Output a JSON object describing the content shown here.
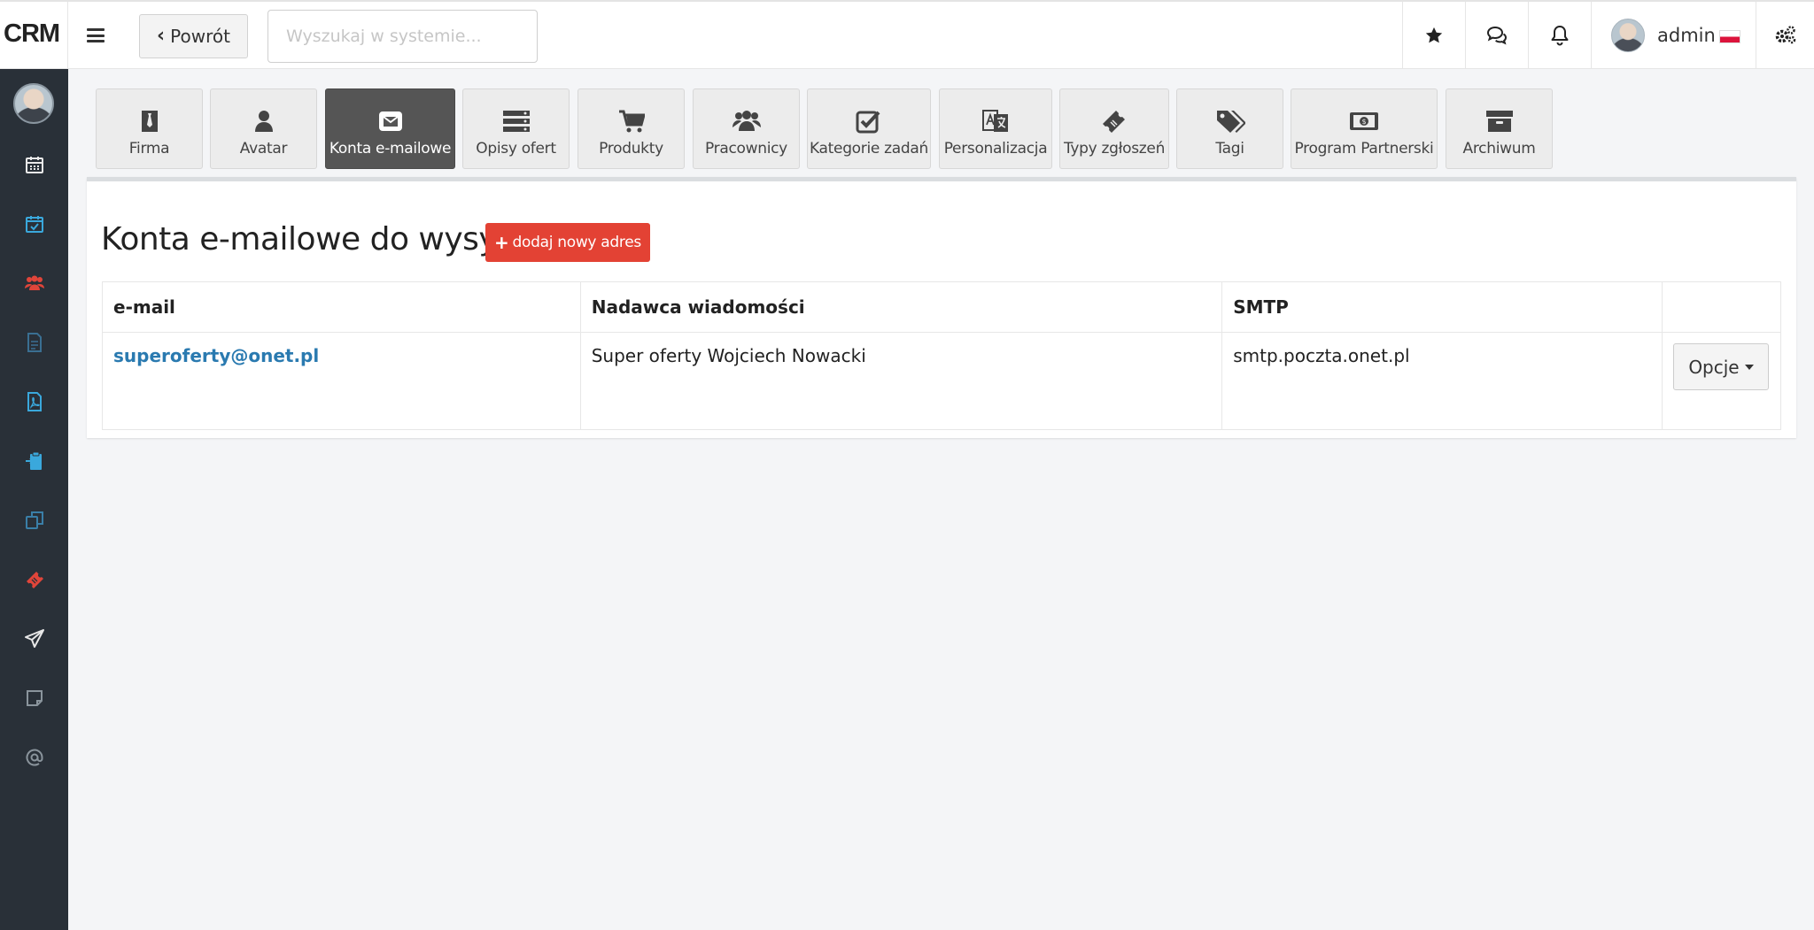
{
  "app": {
    "logo": "CRM"
  },
  "header": {
    "back_label": "Powrót",
    "search_placeholder": "Wyszukaj w systemie...",
    "user_name": "admin"
  },
  "tabs": [
    {
      "label": "Firma",
      "icon": "tie-icon",
      "active": false
    },
    {
      "label": "Avatar",
      "icon": "user-icon",
      "active": false
    },
    {
      "label": "Konta e-mailowe",
      "icon": "envelope-icon",
      "active": true
    },
    {
      "label": "Opisy ofert",
      "icon": "server-icon",
      "active": false
    },
    {
      "label": "Produkty",
      "icon": "cart-icon",
      "active": false
    },
    {
      "label": "Pracownicy",
      "icon": "users-icon",
      "active": false
    },
    {
      "label": "Kategorie zadań",
      "icon": "check-square-icon",
      "active": false
    },
    {
      "label": "Personalizacja",
      "icon": "translate-icon",
      "active": false
    },
    {
      "label": "Typy zgłoszeń",
      "icon": "ticket-icon",
      "active": false
    },
    {
      "label": "Tagi",
      "icon": "tags-icon",
      "active": false
    },
    {
      "label": "Program Partnerski",
      "icon": "money-icon",
      "active": false
    },
    {
      "label": "Archiwum",
      "icon": "archive-icon",
      "active": false
    }
  ],
  "panel": {
    "title": "Konta e-mailowe do wysyłki",
    "add_button": "dodaj nowy adres"
  },
  "table": {
    "headers": [
      "e-mail",
      "Nadawca wiadomości",
      "SMTP",
      ""
    ],
    "rows": [
      {
        "email": "superoferty@onet.pl",
        "sender": "Super oferty Wojciech Nowacki",
        "smtp": "smtp.poczta.onet.pl",
        "options_label": "Opcje"
      }
    ]
  },
  "sidebar": {
    "items": [
      {
        "icon": "calendar-icon",
        "color": "#e8e8e8"
      },
      {
        "icon": "calendar-check-icon",
        "color": "#3aa8dc"
      },
      {
        "icon": "users-icon",
        "color": "#e0453a"
      },
      {
        "icon": "file-icon",
        "color": "#3a6f92"
      },
      {
        "icon": "file-pdf-icon",
        "color": "#3aa8dc"
      },
      {
        "icon": "clipboard-icon",
        "color": "#3aa8dc"
      },
      {
        "icon": "copy-icon",
        "color": "#3a7fa8"
      },
      {
        "icon": "ticket-icon",
        "color": "#e0453a"
      },
      {
        "icon": "paper-plane-icon",
        "color": "#e8e8e8"
      },
      {
        "icon": "sticky-note-icon",
        "color": "#8a949c"
      },
      {
        "icon": "at-icon",
        "color": "#8a949c"
      }
    ]
  },
  "colors": {
    "accent_red": "#e34234",
    "link_blue": "#2a7ab0",
    "sidebar_bg": "#293038",
    "active_tab": "#555555"
  }
}
